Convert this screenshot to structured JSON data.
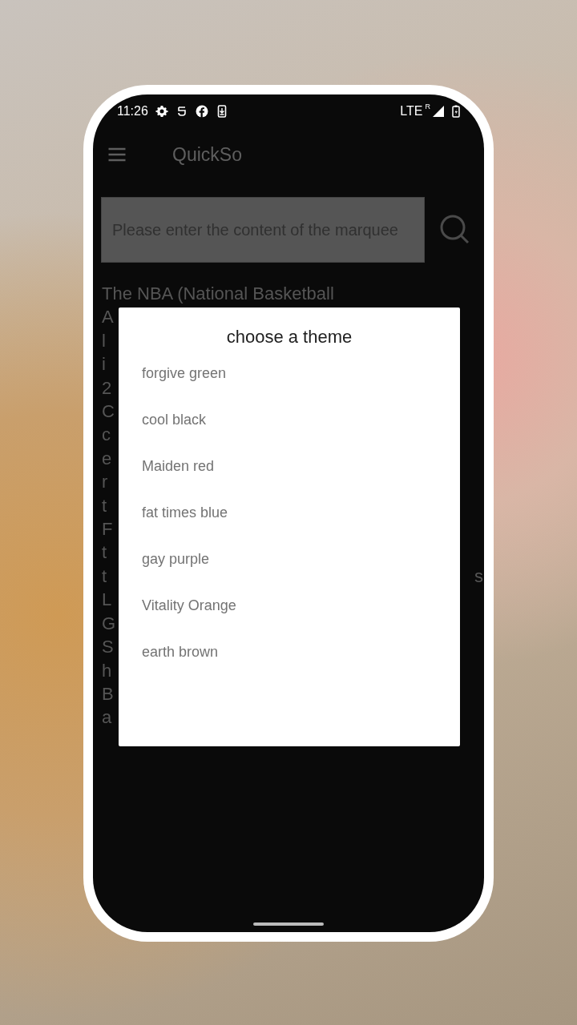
{
  "status_bar": {
    "time": "11:26",
    "network": "LTE",
    "roaming": "R"
  },
  "toolbar": {
    "title": "QuickSo"
  },
  "search": {
    "placeholder": "Please enter the content of the marquee"
  },
  "article": {
    "lines": [
      {
        "text": "The NBA (National Basketball"
      },
      {
        "text": "A"
      },
      {
        "text": "l"
      },
      {
        "text": "i"
      },
      {
        "text": "2"
      },
      {
        "text": "C"
      },
      {
        "text": "c"
      },
      {
        "text": "e"
      },
      {
        "text": "r"
      },
      {
        "text": "t"
      },
      {
        "text": "F"
      },
      {
        "text": "t"
      },
      {
        "text": "t",
        "end": "s"
      },
      {
        "text": "L"
      },
      {
        "text": "G"
      },
      {
        "text": "S"
      },
      {
        "text": "h"
      },
      {
        "text": "B"
      },
      {
        "text": "a"
      }
    ]
  },
  "dialog": {
    "title": "choose a theme",
    "items": [
      {
        "label": "forgive green"
      },
      {
        "label": "cool black"
      },
      {
        "label": "Maiden red"
      },
      {
        "label": "fat times blue"
      },
      {
        "label": "gay purple"
      },
      {
        "label": "Vitality Orange"
      },
      {
        "label": "earth brown"
      }
    ]
  }
}
